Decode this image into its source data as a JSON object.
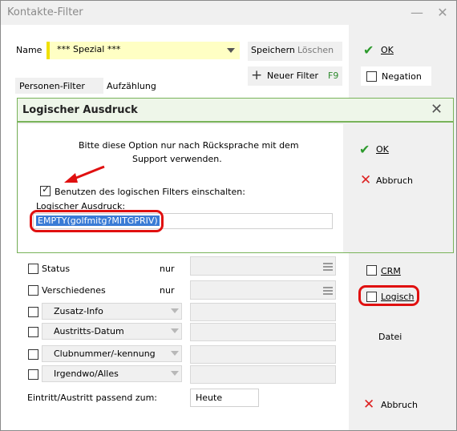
{
  "window": {
    "title": "Kontakte-Filter"
  },
  "form": {
    "name_label": "Name",
    "name_value": "*** Spezial ***",
    "save_label": "Speichern",
    "delete_label": "Löschen",
    "new_filter_label": "Neuer Filter",
    "new_filter_key": "F9",
    "tabs": [
      "Personen-Filter",
      "Aufzählung"
    ]
  },
  "right": {
    "ok_label": "OK",
    "negation_label": "Negation",
    "crm_label": "CRM",
    "logisch_label": "Logisch",
    "datei_label": "Datei",
    "abbruch_label": "Abbruch"
  },
  "rows": [
    {
      "label": "Status",
      "nur": "nur"
    },
    {
      "label": "Verschiedenes",
      "nur": "nur"
    }
  ],
  "combos": [
    "Zusatz-Info",
    "Austritts-Datum",
    "Clubnummer/-kennung",
    "Irgendwo/Alles"
  ],
  "entry": {
    "label": "Eintritt/Austritt passend zum:",
    "value": "Heute"
  },
  "dialog": {
    "title": "Logischer Ausdruck",
    "message_line1": "Bitte diese Option nur nach Rücksprache mit dem",
    "message_line2": "Support verwenden.",
    "checkbox_label": "Benutzen des logischen Filters einschalten:",
    "expr_label": "Logischer Ausdruck:",
    "expr_value": "EMPTY(golfmitg?MITGPRIV)",
    "ok_label": "OK",
    "abbruch_label": "Abbruch"
  },
  "colors": {
    "accent_green": "#79b35a",
    "highlight_red": "#e01010",
    "name_field_yellow": "#ffffc4",
    "selection_blue": "#3a7bd5"
  }
}
